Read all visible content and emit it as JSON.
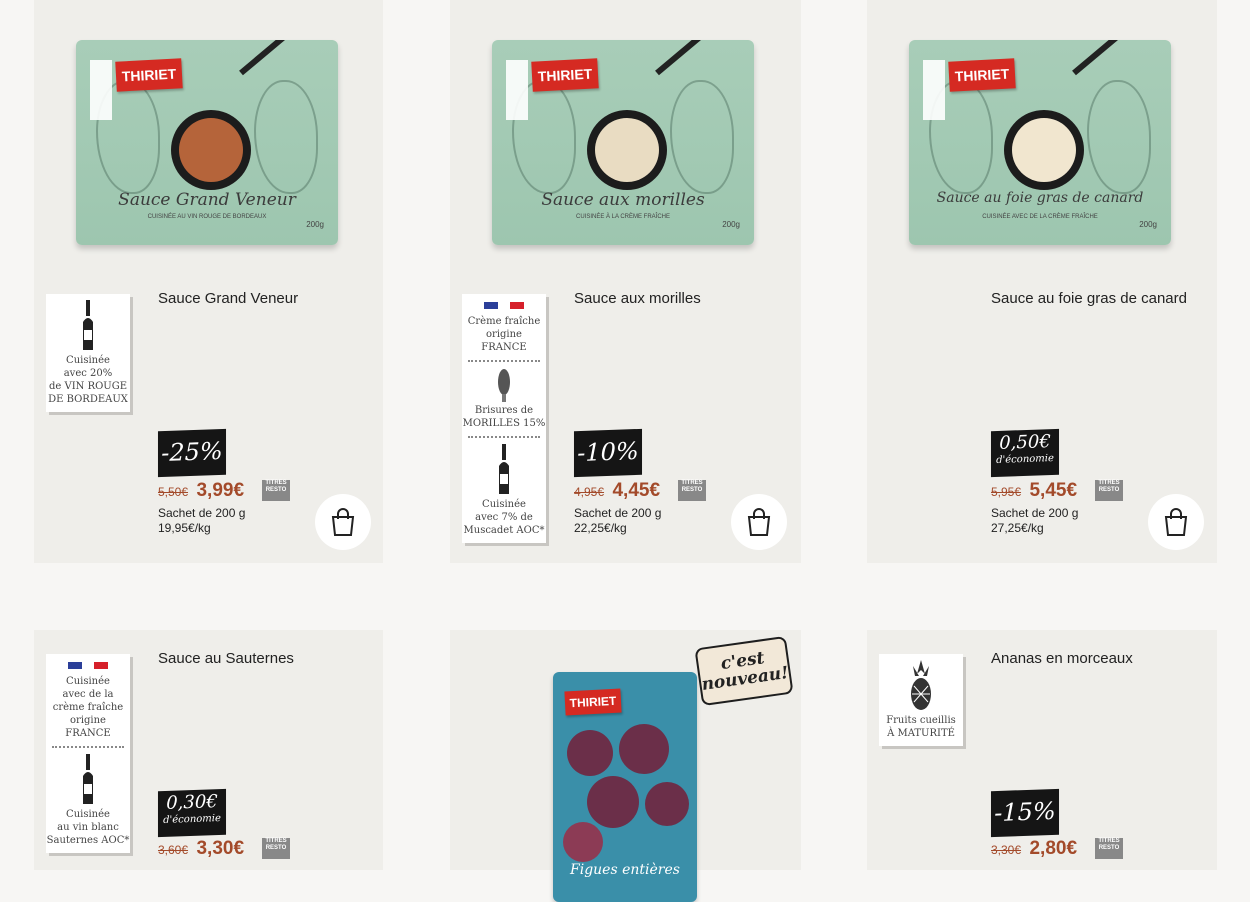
{
  "products": [
    {
      "title": "Sauce Grand Veneur",
      "pack_name": "Sauce Grand Veneur",
      "pack_sub": "CUISINÉE AU VIN ROUGE DE BORDEAUX",
      "brand": "THIRIET",
      "weight": "200g",
      "sauce_color": "#b5643a",
      "badge": "-25%",
      "old_price": "5,50€",
      "new_price": "3,99€",
      "unit": "Sachet de 200 g",
      "per_kg": "19,95€/kg",
      "label": [
        "Cuisinée",
        "avec 20%",
        "de VIN ROUGE",
        "DE BORDEAUX"
      ]
    },
    {
      "title": "Sauce aux morilles",
      "pack_name": "Sauce aux morilles",
      "pack_sub": "CUISINÉE À LA CRÈME FRAÎCHE",
      "brand": "THIRIET",
      "weight": "200g",
      "sauce_color": "#e9dcc2",
      "badge": "-10%",
      "old_price": "4,95€",
      "new_price": "4,45€",
      "unit": "Sachet de 200 g",
      "per_kg": "22,25€/kg",
      "label_a": [
        "Crème fraîche",
        "origine",
        "FRANCE"
      ],
      "label_b": [
        "Brisures de",
        "MORILLES 15%"
      ],
      "label_c": [
        "Cuisinée",
        "avec 7% de",
        "Muscadet AOC*"
      ]
    },
    {
      "title": "Sauce au foie gras de canard",
      "pack_name": "Sauce au foie gras de canard",
      "pack_sub": "CUISINÉE AVEC DE LA CRÈME FRAÎCHE",
      "brand": "THIRIET",
      "weight": "200g",
      "sauce_color": "#f1e6cf",
      "badge_amt": "0,50€",
      "badge_eco": "d'économie",
      "old_price": "5,95€",
      "new_price": "5,45€",
      "unit": "Sachet de 200 g",
      "per_kg": "27,25€/kg"
    },
    {
      "title": "Sauce au Sauternes",
      "badge_amt": "0,30€",
      "badge_eco": "d'économie",
      "old_price": "3,60€",
      "new_price": "3,30€",
      "label_a": [
        "Cuisinée",
        "avec de la",
        "crème fraîche",
        "origine FRANCE"
      ],
      "label_b": [
        "Cuisinée",
        "au vin blanc",
        "Sauternes AOC*"
      ]
    },
    {
      "neuf": "c'est nouveau!",
      "brand": "THIRIET",
      "pack_name": "Figues entières"
    },
    {
      "title": "Ananas en morceaux",
      "badge": "-15%",
      "old_price": "3,30€",
      "new_price": "2,80€",
      "label": [
        "Fruits cueillis",
        "À MATURITÉ"
      ]
    }
  ],
  "resto_label": "TITRES RESTO",
  "cart_icon": "shopping-bag-icon",
  "colors": {
    "price": "#a34a2a",
    "badge_bg": "#151515",
    "card_bg": "#efeeea",
    "flag_blue": "#2b3f99",
    "flag_red": "#d6202a"
  }
}
